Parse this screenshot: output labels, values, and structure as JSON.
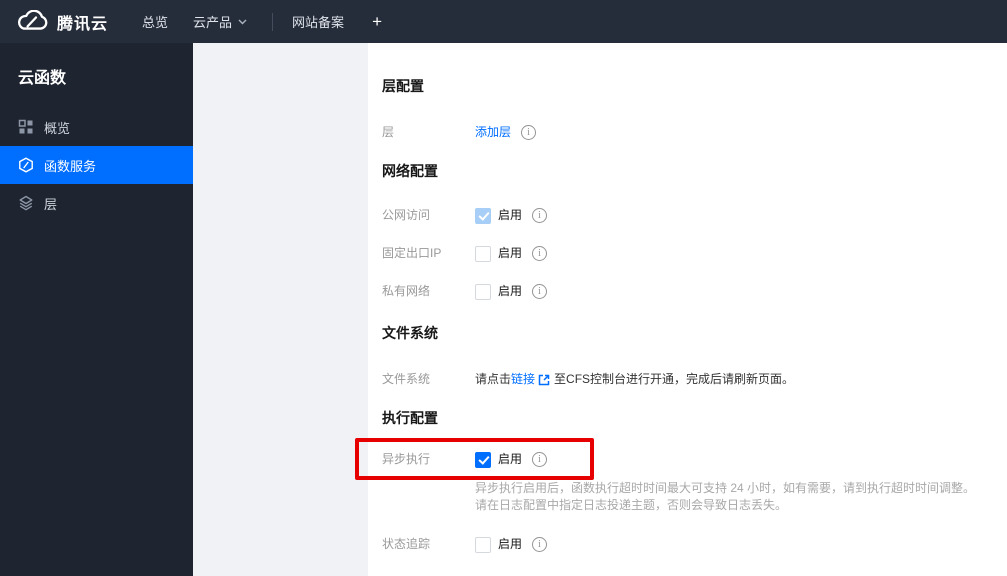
{
  "topbar": {
    "logo_text": "腾讯云",
    "nav": {
      "overview": "总览",
      "products": "云产品",
      "icp": "网站备案",
      "add": "+"
    }
  },
  "sidebar": {
    "title": "云函数",
    "items": [
      {
        "label": "概览",
        "icon": "grid-icon",
        "active": false
      },
      {
        "label": "函数服务",
        "icon": "function-icon",
        "active": true
      },
      {
        "label": "层",
        "icon": "layers-icon",
        "active": false
      }
    ]
  },
  "main": {
    "layer_section": {
      "title": "层配置",
      "row": {
        "label": "层",
        "link": "添加层"
      }
    },
    "network_section": {
      "title": "网络配置",
      "rows": [
        {
          "label": "公网访问",
          "checkbox": "checked-disabled",
          "text": "启用"
        },
        {
          "label": "固定出口IP",
          "checkbox": "unchecked",
          "text": "启用"
        },
        {
          "label": "私有网络",
          "checkbox": "unchecked",
          "text": "启用"
        }
      ]
    },
    "file_section": {
      "title": "文件系统",
      "row": {
        "label": "文件系统",
        "text_before": "请点击",
        "link": "链接",
        "text_after": "至CFS控制台进行开通，完成后请刷新页面。"
      }
    },
    "exec_section": {
      "title": "执行配置",
      "async_row": {
        "label": "异步执行",
        "checkbox": "checked",
        "text": "启用"
      },
      "desc_line1": "异步执行启用后，函数执行超时时间最大可支持 24 小时，如有需要，请到执行超时时间调整。",
      "desc_line2": "请在日志配置中指定日志投递主题，否则会导致日志丢失。",
      "trace_row": {
        "label": "状态追踪",
        "checkbox": "unchecked",
        "text": "启用"
      }
    }
  },
  "colors": {
    "accent": "#006eff",
    "highlight_red": "#e60000",
    "topbar_bg": "#252c3a",
    "sidebar_bg": "#1e2430",
    "panel_bg": "#f0f2f5",
    "checked_disabled": "#a6cef7"
  }
}
